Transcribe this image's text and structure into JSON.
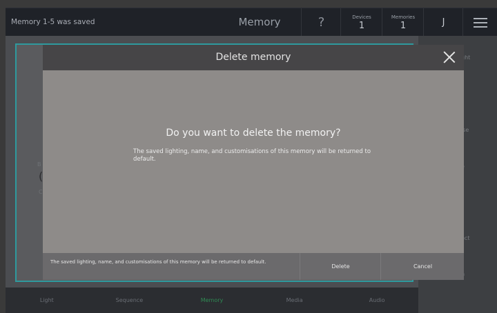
{
  "topbar": {
    "status_message": "Memory 1-5 was saved",
    "title": "Memory",
    "help_symbol": "?",
    "devices_label": "Devices",
    "devices_count": "1",
    "memories_label": "Memories",
    "memories_count": "1",
    "user_initial": "J"
  },
  "background": {
    "fragments": [
      "B",
      "(",
      "C"
    ],
    "right_panel_items": [
      "ght",
      "ise",
      "e",
      "r",
      "ect",
      "n"
    ]
  },
  "bottom_nav": {
    "tabs": [
      {
        "label": "Light"
      },
      {
        "label": "Sequence"
      },
      {
        "label": "Memory"
      },
      {
        "label": "Media"
      },
      {
        "label": "Audio"
      }
    ],
    "active_tab": "Memory",
    "active_color": "#2f8a53"
  },
  "modal": {
    "title": "Delete memory",
    "question": "Do you want to delete the memory?",
    "description": "The saved lighting, name, and customisations of this memory will be returned to default.",
    "footer_description": "The saved lighting, name, and customisations of this memory will be returned to default.",
    "delete_label": "Delete",
    "cancel_label": "Cancel"
  },
  "colors": {
    "accent_teal": "#2e9a9e",
    "topbar_bg": "#1f2228",
    "modal_bg": "#8e8b89"
  }
}
